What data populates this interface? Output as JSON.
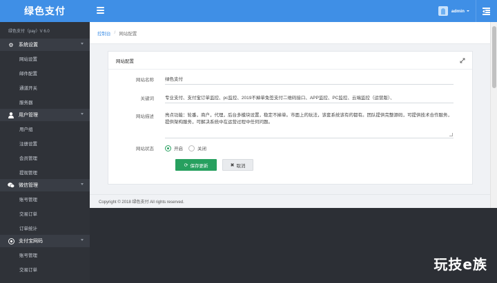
{
  "brand": "绿色支付",
  "version": "绿色支付（pay）V 6.0",
  "sidebar": {
    "groups": [
      {
        "icon": "gear-icon",
        "label": "系统设置",
        "items": [
          "网站设置",
          "邮件配置",
          "通道开关",
          "服务器"
        ]
      },
      {
        "icon": "user-icon",
        "label": "用户管理",
        "items": [
          "用户组",
          "注册设置",
          "会员管理",
          "提现管理"
        ]
      },
      {
        "icon": "wechat-icon",
        "label": "微信管理",
        "items": [
          "账号管理",
          "交易订单",
          "订单统计"
        ]
      },
      {
        "icon": "alipay-icon",
        "label": "支付宝网码",
        "items": [
          "账号管理",
          "交易订单"
        ]
      }
    ]
  },
  "topbar": {
    "username": "admin"
  },
  "breadcrumb": {
    "home": "控制台",
    "separator": "/",
    "current": "网站配置"
  },
  "card": {
    "title": "网站配置",
    "fields": {
      "site_name": {
        "label": "网站名称",
        "value": "绿色支付"
      },
      "keywords": {
        "label": "关键词",
        "value": "专业支付、支付宝订单监控、pc监控、2019不掉单免签支付二维码接口、APP监控、PC监控、云端监控（运营版）、"
      },
      "description": {
        "label": "网站描述",
        "value": "亮点功能：轮番，商户，代理，后台多模块设置，稳定不掉单。市面上的玩法，该套系统该有的都有。团队提供完整源码，可提供技术合作服务，提供架构服务，可解决系统中在运营过程中任何问题。"
      },
      "status": {
        "label": "网站状态",
        "options": [
          "开启",
          "关闭"
        ],
        "selected": "开启"
      }
    },
    "save_label": "保存更新",
    "cancel_label": "取消"
  },
  "footer": "Copyright © 2018 绿色支付 All rights reserved.",
  "watermark": "玩技e族",
  "colors": {
    "primary": "#3f8fe6",
    "sidebar": "#2f3238",
    "success": "#27a05f"
  }
}
